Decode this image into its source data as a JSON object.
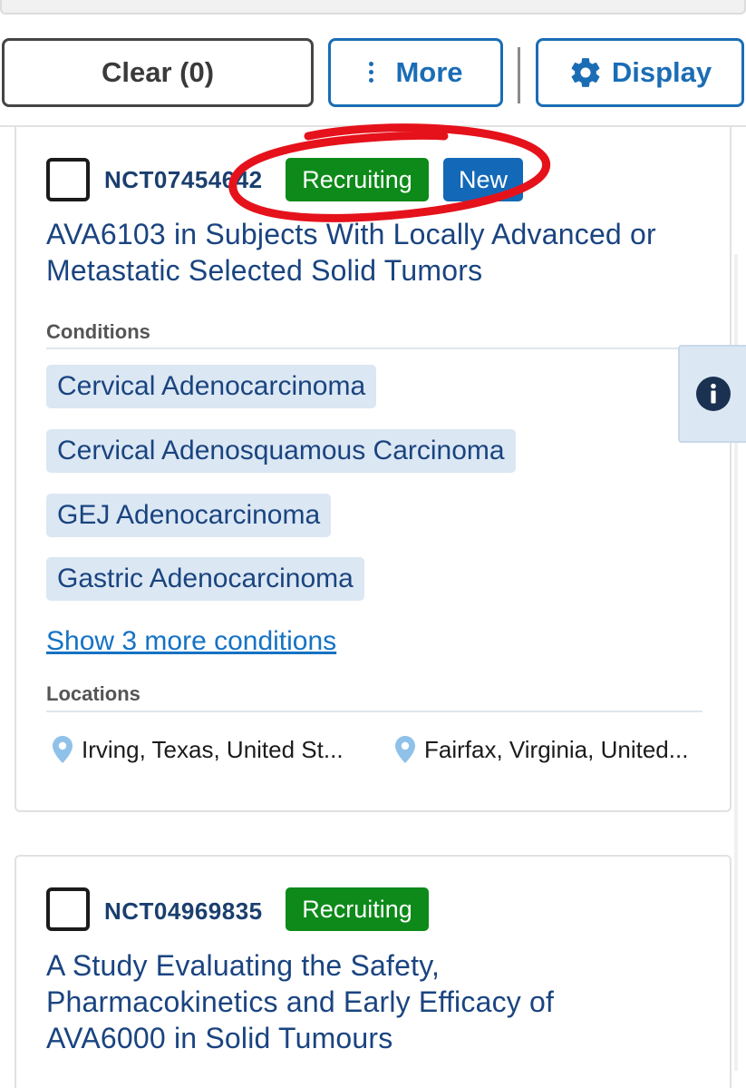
{
  "toolbar": {
    "clear_label": "Clear (0)",
    "more_label": "More",
    "display_label": "Display"
  },
  "results": [
    {
      "nct_id": "NCT07454642",
      "status": "Recruiting",
      "badge_new": "New",
      "title_line1": "AVA6103 in Subjects With Locally Advanced or",
      "title_line2": "Metastatic Selected Solid Tumors",
      "conditions_label": "Conditions",
      "conditions": [
        "Cervical Adenocarcinoma",
        "Cervical Adenosquamous Carcinoma",
        "GEJ Adenocarcinoma",
        "Gastric Adenocarcinoma"
      ],
      "show_more": "Show 3 more conditions",
      "locations_label": "Locations",
      "locations": [
        "Irving, Texas, United St...",
        "Fairfax, Virginia, United..."
      ]
    },
    {
      "nct_id": "NCT04969835",
      "status": "Recruiting",
      "title_line1": "A Study Evaluating the Safety,",
      "title_line2": "Pharmacokinetics and Early Efficacy of",
      "title_line3": "AVA6000 in Solid Tumours"
    }
  ],
  "icons": {
    "more": "kebab-icon",
    "display": "gear-icon",
    "location": "map-pin-icon",
    "info": "info-icon"
  },
  "colors": {
    "primary": "#1a6db5",
    "recruiting": "#0d8a19",
    "new_badge": "#1369b7",
    "chip_bg": "#dbe7f3",
    "title_text": "#1a4480",
    "annotation": "#e5121b"
  }
}
